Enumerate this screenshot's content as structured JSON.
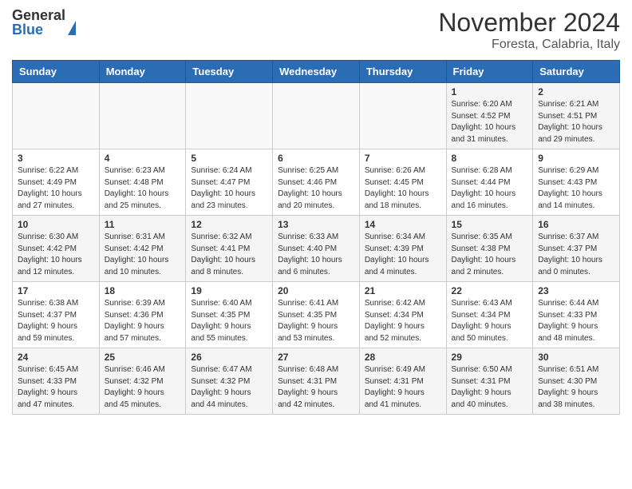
{
  "logo": {
    "general": "General",
    "blue": "Blue"
  },
  "header": {
    "month": "November 2024",
    "location": "Foresta, Calabria, Italy"
  },
  "weekdays": [
    "Sunday",
    "Monday",
    "Tuesday",
    "Wednesday",
    "Thursday",
    "Friday",
    "Saturday"
  ],
  "weeks": [
    [
      {
        "day": "",
        "info": ""
      },
      {
        "day": "",
        "info": ""
      },
      {
        "day": "",
        "info": ""
      },
      {
        "day": "",
        "info": ""
      },
      {
        "day": "",
        "info": ""
      },
      {
        "day": "1",
        "info": "Sunrise: 6:20 AM\nSunset: 4:52 PM\nDaylight: 10 hours\nand 31 minutes."
      },
      {
        "day": "2",
        "info": "Sunrise: 6:21 AM\nSunset: 4:51 PM\nDaylight: 10 hours\nand 29 minutes."
      }
    ],
    [
      {
        "day": "3",
        "info": "Sunrise: 6:22 AM\nSunset: 4:49 PM\nDaylight: 10 hours\nand 27 minutes."
      },
      {
        "day": "4",
        "info": "Sunrise: 6:23 AM\nSunset: 4:48 PM\nDaylight: 10 hours\nand 25 minutes."
      },
      {
        "day": "5",
        "info": "Sunrise: 6:24 AM\nSunset: 4:47 PM\nDaylight: 10 hours\nand 23 minutes."
      },
      {
        "day": "6",
        "info": "Sunrise: 6:25 AM\nSunset: 4:46 PM\nDaylight: 10 hours\nand 20 minutes."
      },
      {
        "day": "7",
        "info": "Sunrise: 6:26 AM\nSunset: 4:45 PM\nDaylight: 10 hours\nand 18 minutes."
      },
      {
        "day": "8",
        "info": "Sunrise: 6:28 AM\nSunset: 4:44 PM\nDaylight: 10 hours\nand 16 minutes."
      },
      {
        "day": "9",
        "info": "Sunrise: 6:29 AM\nSunset: 4:43 PM\nDaylight: 10 hours\nand 14 minutes."
      }
    ],
    [
      {
        "day": "10",
        "info": "Sunrise: 6:30 AM\nSunset: 4:42 PM\nDaylight: 10 hours\nand 12 minutes."
      },
      {
        "day": "11",
        "info": "Sunrise: 6:31 AM\nSunset: 4:42 PM\nDaylight: 10 hours\nand 10 minutes."
      },
      {
        "day": "12",
        "info": "Sunrise: 6:32 AM\nSunset: 4:41 PM\nDaylight: 10 hours\nand 8 minutes."
      },
      {
        "day": "13",
        "info": "Sunrise: 6:33 AM\nSunset: 4:40 PM\nDaylight: 10 hours\nand 6 minutes."
      },
      {
        "day": "14",
        "info": "Sunrise: 6:34 AM\nSunset: 4:39 PM\nDaylight: 10 hours\nand 4 minutes."
      },
      {
        "day": "15",
        "info": "Sunrise: 6:35 AM\nSunset: 4:38 PM\nDaylight: 10 hours\nand 2 minutes."
      },
      {
        "day": "16",
        "info": "Sunrise: 6:37 AM\nSunset: 4:37 PM\nDaylight: 10 hours\nand 0 minutes."
      }
    ],
    [
      {
        "day": "17",
        "info": "Sunrise: 6:38 AM\nSunset: 4:37 PM\nDaylight: 9 hours\nand 59 minutes."
      },
      {
        "day": "18",
        "info": "Sunrise: 6:39 AM\nSunset: 4:36 PM\nDaylight: 9 hours\nand 57 minutes."
      },
      {
        "day": "19",
        "info": "Sunrise: 6:40 AM\nSunset: 4:35 PM\nDaylight: 9 hours\nand 55 minutes."
      },
      {
        "day": "20",
        "info": "Sunrise: 6:41 AM\nSunset: 4:35 PM\nDaylight: 9 hours\nand 53 minutes."
      },
      {
        "day": "21",
        "info": "Sunrise: 6:42 AM\nSunset: 4:34 PM\nDaylight: 9 hours\nand 52 minutes."
      },
      {
        "day": "22",
        "info": "Sunrise: 6:43 AM\nSunset: 4:34 PM\nDaylight: 9 hours\nand 50 minutes."
      },
      {
        "day": "23",
        "info": "Sunrise: 6:44 AM\nSunset: 4:33 PM\nDaylight: 9 hours\nand 48 minutes."
      }
    ],
    [
      {
        "day": "24",
        "info": "Sunrise: 6:45 AM\nSunset: 4:33 PM\nDaylight: 9 hours\nand 47 minutes."
      },
      {
        "day": "25",
        "info": "Sunrise: 6:46 AM\nSunset: 4:32 PM\nDaylight: 9 hours\nand 45 minutes."
      },
      {
        "day": "26",
        "info": "Sunrise: 6:47 AM\nSunset: 4:32 PM\nDaylight: 9 hours\nand 44 minutes."
      },
      {
        "day": "27",
        "info": "Sunrise: 6:48 AM\nSunset: 4:31 PM\nDaylight: 9 hours\nand 42 minutes."
      },
      {
        "day": "28",
        "info": "Sunrise: 6:49 AM\nSunset: 4:31 PM\nDaylight: 9 hours\nand 41 minutes."
      },
      {
        "day": "29",
        "info": "Sunrise: 6:50 AM\nSunset: 4:31 PM\nDaylight: 9 hours\nand 40 minutes."
      },
      {
        "day": "30",
        "info": "Sunrise: 6:51 AM\nSunset: 4:30 PM\nDaylight: 9 hours\nand 38 minutes."
      }
    ]
  ]
}
